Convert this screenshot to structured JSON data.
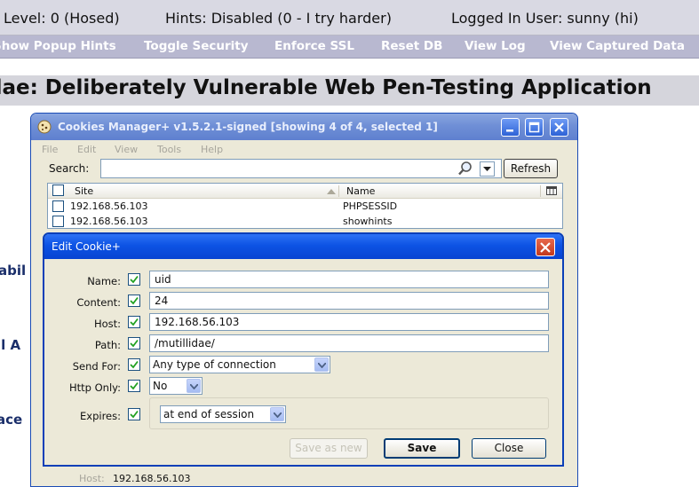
{
  "status_bar": {
    "level": "Level: 0 (Hosed)",
    "hints": "Hints: Disabled (0 - I try harder)",
    "user": "Logged In User: sunny (hi)"
  },
  "nav": [
    "Show Popup Hints",
    "Toggle Security",
    "Enforce SSL",
    "Reset DB",
    "View Log",
    "View Captured Data"
  ],
  "banner": "dae: Deliberately Vulnerable Web Pen-Testing Application",
  "side_fragments": [
    "abil",
    "il A",
    "ace"
  ],
  "cookies_manager": {
    "title": "Cookies Manager+ v1.5.2.1-signed [showing 4 of 4, selected 1]",
    "menu": [
      "File",
      "Edit",
      "View",
      "Tools",
      "Help"
    ],
    "search_label": "Search:",
    "search_value": "",
    "refresh_label": "Refresh",
    "columns": {
      "site": "Site",
      "name": "Name"
    },
    "rows": [
      {
        "site": "192.168.56.103",
        "name": "PHPSESSID"
      },
      {
        "site": "192.168.56.103",
        "name": "showhints"
      }
    ],
    "detail_host_label": "Host:",
    "detail_host_value": "192.168.56.103"
  },
  "edit_cookie": {
    "title": "Edit Cookie+",
    "fields": {
      "name_label": "Name:",
      "name_value": "uid",
      "content_label": "Content:",
      "content_value": "24",
      "host_label": "Host:",
      "host_value": "192.168.56.103",
      "path_label": "Path:",
      "path_value": "/mutillidae/",
      "send_for_label": "Send For:",
      "send_for_value": "Any type of connection",
      "http_only_label": "Http Only:",
      "http_only_value": "No",
      "expires_label": "Expires:",
      "expires_value": "at end of session"
    },
    "buttons": {
      "save_as_new": "Save as new",
      "save": "Save",
      "close": "Close"
    }
  }
}
